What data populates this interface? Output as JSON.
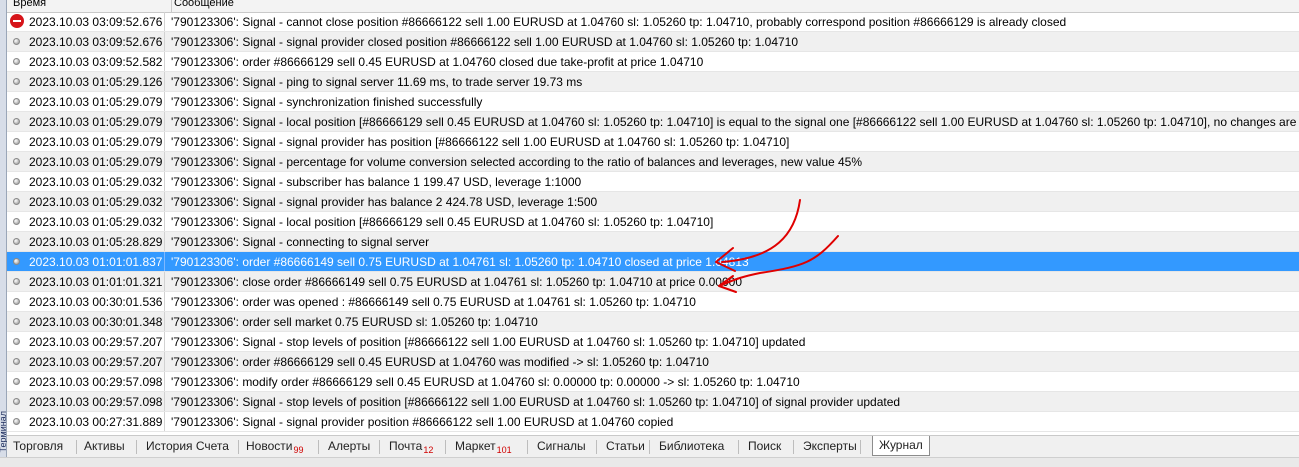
{
  "window": {
    "side_label": "Терминал"
  },
  "journal": {
    "columns": {
      "time": "Время",
      "message": "Сообщение"
    },
    "rows": [
      {
        "time": "2023.10.03 03:09:52.676",
        "message": "'790123306': Signal - cannot close position #86666122 sell 1.00 EURUSD at 1.04760 sl: 1.05260 tp: 1.04710, probably correspond position #86666129 is already closed",
        "level": "error"
      },
      {
        "time": "2023.10.03 03:09:52.676",
        "message": "'790123306': Signal - signal provider closed position #86666122 sell 1.00 EURUSD at 1.04760 sl: 1.05260 tp: 1.04710",
        "level": "info"
      },
      {
        "time": "2023.10.03 03:09:52.582",
        "message": "'790123306': order #86666129 sell 0.45 EURUSD at 1.04760 closed due take-profit at price 1.04710",
        "level": "info"
      },
      {
        "time": "2023.10.03 01:05:29.126",
        "message": "'790123306': Signal - ping to signal server 11.69 ms, to trade server 19.73 ms",
        "level": "info"
      },
      {
        "time": "2023.10.03 01:05:29.079",
        "message": "'790123306': Signal - synchronization finished successfully",
        "level": "info"
      },
      {
        "time": "2023.10.03 01:05:29.079",
        "message": "'790123306': Signal - local position [#86666129 sell 0.45 EURUSD at 1.04760 sl: 1.05260 tp: 1.04710] is equal to the signal one [#86666122 sell 1.00 EURUSD at 1.04760 sl: 1.05260 tp: 1.04710], no changes are made",
        "level": "info"
      },
      {
        "time": "2023.10.03 01:05:29.079",
        "message": "'790123306': Signal - signal provider has position [#86666122 sell 1.00 EURUSD at 1.04760 sl: 1.05260 tp: 1.04710]",
        "level": "info"
      },
      {
        "time": "2023.10.03 01:05:29.079",
        "message": "'790123306': Signal - percentage for volume conversion selected according to the ratio of balances and leverages, new value 45%",
        "level": "info"
      },
      {
        "time": "2023.10.03 01:05:29.032",
        "message": "'790123306': Signal - subscriber has balance 1 199.47 USD, leverage 1:1000",
        "level": "info"
      },
      {
        "time": "2023.10.03 01:05:29.032",
        "message": "'790123306': Signal - signal provider has balance 2 424.78 USD, leverage 1:500",
        "level": "info"
      },
      {
        "time": "2023.10.03 01:05:29.032",
        "message": "'790123306': Signal - local position [#86666129 sell 0.45 EURUSD at 1.04760 sl: 1.05260 tp: 1.04710]",
        "level": "info"
      },
      {
        "time": "2023.10.03 01:05:28.829",
        "message": "'790123306': Signal - connecting to signal server",
        "level": "info"
      },
      {
        "time": "2023.10.03 01:01:01.837",
        "message": "'790123306': order #86666149 sell 0.75 EURUSD at 1.04761 sl: 1.05260 tp: 1.04710 closed at price 1.04813",
        "level": "info",
        "selected": true
      },
      {
        "time": "2023.10.03 01:01:01.321",
        "message": "'790123306': close order #86666149 sell 0.75 EURUSD at 1.04761 sl: 1.05260 tp: 1.04710 at price 0.00000",
        "level": "info"
      },
      {
        "time": "2023.10.03 00:30:01.536",
        "message": "'790123306': order was opened : #86666149 sell 0.75 EURUSD at 1.04761 sl: 1.05260 tp: 1.04710",
        "level": "info"
      },
      {
        "time": "2023.10.03 00:30:01.348",
        "message": "'790123306': order sell market 0.75 EURUSD sl: 1.05260 tp: 1.04710",
        "level": "info"
      },
      {
        "time": "2023.10.03 00:29:57.207",
        "message": "'790123306': Signal - stop levels of position [#86666122 sell 1.00 EURUSD at 1.04760 sl: 1.05260 tp: 1.04710] updated",
        "level": "info"
      },
      {
        "time": "2023.10.03 00:29:57.207",
        "message": "'790123306': order #86666129 sell 0.45 EURUSD at 1.04760 was modified -> sl: 1.05260 tp: 1.04710",
        "level": "info"
      },
      {
        "time": "2023.10.03 00:29:57.098",
        "message": "'790123306': modify order #86666129 sell 0.45 EURUSD at 1.04760 sl: 0.00000 tp: 0.00000 -> sl: 1.05260 tp: 1.04710",
        "level": "info"
      },
      {
        "time": "2023.10.03 00:29:57.098",
        "message": "'790123306': Signal - stop levels of position [#86666122 sell 1.00 EURUSD at 1.04760 sl: 1.05260 tp: 1.04710] of signal provider updated",
        "level": "info"
      },
      {
        "time": "2023.10.03 00:27:31.889",
        "message": "'790123306': Signal - signal provider position #86666122 sell 1.00 EURUSD at 1.04760 copied",
        "level": "info"
      }
    ]
  },
  "tabs": [
    {
      "label": "Торговля",
      "badge": ""
    },
    {
      "label": "Активы",
      "badge": ""
    },
    {
      "label": "История Счета",
      "badge": ""
    },
    {
      "label": "Новости",
      "badge": "99"
    },
    {
      "label": "Алерты",
      "badge": ""
    },
    {
      "label": "Почта",
      "badge": "12"
    },
    {
      "label": "Маркет",
      "badge": "101"
    },
    {
      "label": "Сигналы",
      "badge": ""
    },
    {
      "label": "Статьи",
      "badge": ""
    },
    {
      "label": "Библиотека",
      "badge": ""
    },
    {
      "label": "Поиск",
      "badge": ""
    },
    {
      "label": "Эксперты",
      "badge": ""
    },
    {
      "label": "Журнал",
      "badge": "",
      "active": true
    }
  ],
  "colors": {
    "selection": "#3399ff",
    "annotation": "#e00000",
    "badge": "#d00000",
    "error_icon": "#d6151a"
  }
}
